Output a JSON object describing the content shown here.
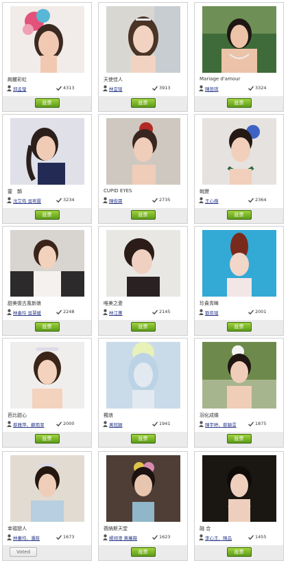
{
  "colors": {
    "vote_button": "#6aa51f",
    "author_link": "#2b3a8a",
    "card_border": "#cfcfcf"
  },
  "entries": [
    {
      "title": "絢麗彩虹",
      "author": "邱孟瑩",
      "votes": "4313",
      "button": "投票",
      "voted": false
    },
    {
      "title": "天使佳人",
      "author": "林宜瑄",
      "votes": "3913",
      "button": "投票",
      "voted": false
    },
    {
      "title": "Mariage d'amour",
      "author": "陳茵琪",
      "votes": "3324",
      "button": "投票",
      "voted": false
    },
    {
      "title": "靈　韻",
      "author": "沈艾筠 吳宥霆",
      "votes": "3234",
      "button": "投票",
      "voted": false
    },
    {
      "title": "CUPID EYES",
      "author": "陳俊霖",
      "votes": "2735",
      "button": "投票",
      "voted": false
    },
    {
      "title": "蛻變",
      "author": "王心蘋",
      "votes": "2364",
      "button": "投票",
      "voted": false
    },
    {
      "title": "甜美復古風新娘",
      "author": "林秦玲 吳慧媛",
      "votes": "2248",
      "button": "投票",
      "voted": false
    },
    {
      "title": "唯美之愛",
      "author": "林江蕙",
      "votes": "2145",
      "button": "投票",
      "voted": false
    },
    {
      "title": "珍貴青睞",
      "author": "劉奕瑄",
      "votes": "2001",
      "button": "投票",
      "voted": false
    },
    {
      "title": "芭比甜心",
      "author": "蔡雅萍、蘇雨潔",
      "votes": "2000",
      "button": "投票",
      "voted": false
    },
    {
      "title": "獨浪",
      "author": "黃冠穎",
      "votes": "1941",
      "button": "投票",
      "voted": false
    },
    {
      "title": "羽化成蝶",
      "author": "陳宇婷、蔡穎澐",
      "votes": "1875",
      "button": "投票",
      "voted": false
    },
    {
      "title": "幸福戀人",
      "author": "林蓁均、潘筱",
      "votes": "1673",
      "button": "Voted",
      "voted": true
    },
    {
      "title": "薇納斯天堂",
      "author": "楊翊澄 黃蘿薇",
      "votes": "1623",
      "button": "投票",
      "voted": false
    },
    {
      "title": "融 合",
      "author": "李心王、陳品",
      "votes": "1455",
      "button": "投票",
      "voted": false
    }
  ]
}
